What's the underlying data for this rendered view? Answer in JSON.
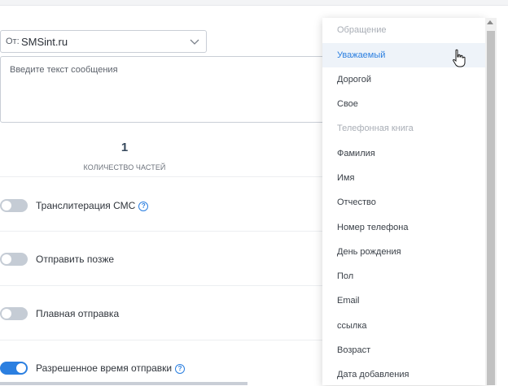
{
  "sender": {
    "prefix": "От:",
    "value": "SMSint.ru"
  },
  "message": {
    "placeholder": "Введите текст сообщения"
  },
  "parts": {
    "count": "1",
    "label": "КОЛИЧЕСТВО ЧАСТЕЙ"
  },
  "options": [
    {
      "label": "Транслитерация СМС",
      "enabled": false,
      "help": true
    },
    {
      "label": "Отправить позже",
      "enabled": false,
      "help": false
    },
    {
      "label": "Плавная отправка",
      "enabled": false,
      "help": false
    },
    {
      "label": "Разрешенное время отправки",
      "enabled": true,
      "help": true
    }
  ],
  "help_glyph": "?",
  "dropdown": {
    "items": [
      {
        "label": "Обращение",
        "type": "header"
      },
      {
        "label": "Уважаемый",
        "type": "item",
        "hovered": true
      },
      {
        "label": "Дорогой",
        "type": "item"
      },
      {
        "label": "Свое",
        "type": "item"
      },
      {
        "label": "Телефонная книга",
        "type": "header"
      },
      {
        "label": "Фамилия",
        "type": "item"
      },
      {
        "label": "Имя",
        "type": "item"
      },
      {
        "label": "Отчество",
        "type": "item"
      },
      {
        "label": "Номер телефона",
        "type": "item"
      },
      {
        "label": "День рождения",
        "type": "item"
      },
      {
        "label": "Пол",
        "type": "item"
      },
      {
        "label": "Email",
        "type": "item"
      },
      {
        "label": "ссылка",
        "type": "item"
      },
      {
        "label": "Возраст",
        "type": "item"
      },
      {
        "label": "Дата добавления",
        "type": "item"
      }
    ]
  },
  "colors": {
    "accent": "#2b7fe0",
    "toggle_off": "#c5ccd5",
    "header_text": "#a9aeb6"
  }
}
